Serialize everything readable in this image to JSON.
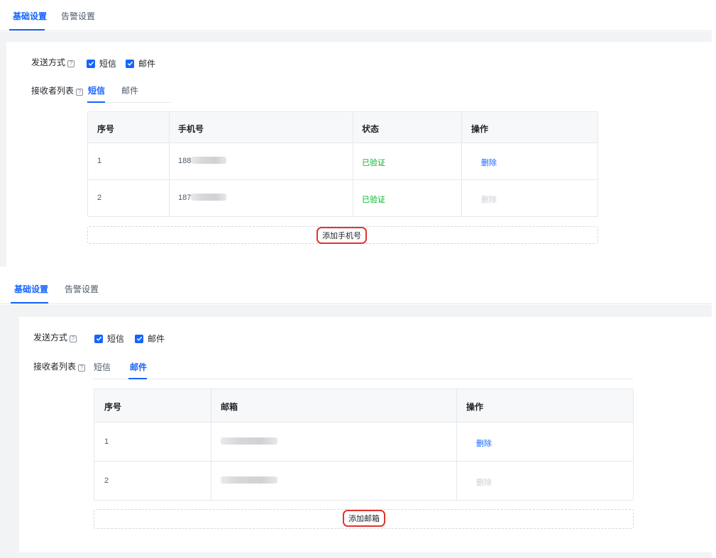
{
  "colors": {
    "accent": "#1664ff",
    "verified": "#00b42a",
    "highlight": "#e03530",
    "disabled": "#c9cdd4"
  },
  "icons": {
    "help": "question-square-icon",
    "check": "checkmark-icon"
  },
  "panels": [
    {
      "top_tabs": [
        "基础设置",
        "告警设置"
      ],
      "send_mode_label": "发送方式",
      "help_glyph": "?",
      "checkbox_sms": "短信",
      "checkbox_email": "邮件",
      "receivers_label": "接收者列表",
      "sub_tabs": [
        "短信",
        "邮件"
      ],
      "table": {
        "headers": [
          "序号",
          "手机号",
          "状态",
          "操作"
        ],
        "rows": [
          {
            "no": "1",
            "value": "188",
            "status": "已验证",
            "action": "删除"
          },
          {
            "no": "2",
            "value": "187",
            "status": "已验证",
            "action": "删除"
          }
        ]
      },
      "add_button": "添加手机号"
    },
    {
      "top_tabs": [
        "基础设置",
        "告警设置"
      ],
      "send_mode_label": "发送方式",
      "help_glyph": "?",
      "checkbox_sms": "短信",
      "checkbox_email": "邮件",
      "receivers_label": "接收者列表",
      "sub_tabs": [
        "短信",
        "邮件"
      ],
      "table": {
        "headers": [
          "序号",
          "邮箱",
          "操作"
        ],
        "rows": [
          {
            "no": "1",
            "value": "",
            "action": "删除"
          },
          {
            "no": "2",
            "value": "",
            "action": "删除"
          }
        ]
      },
      "add_button": "添加邮箱"
    }
  ]
}
